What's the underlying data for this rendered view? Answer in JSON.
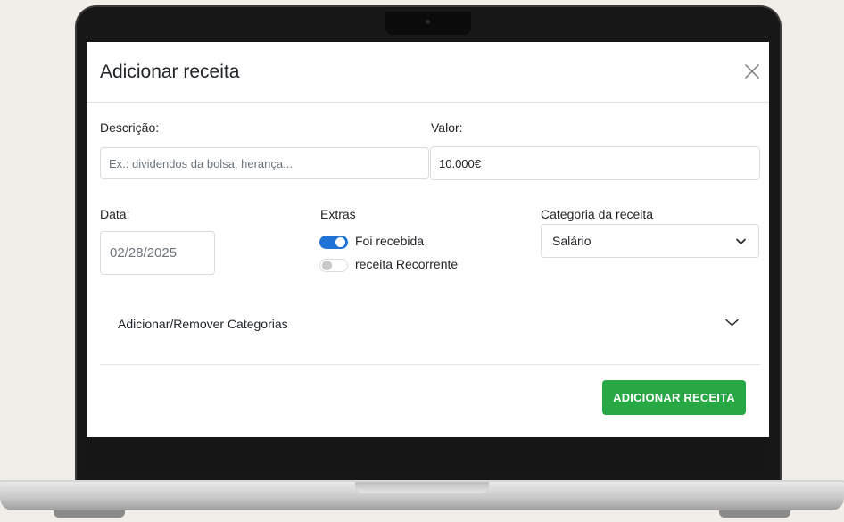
{
  "modal": {
    "title": "Adicionar receita",
    "close_icon": "close-icon"
  },
  "form": {
    "descricao": {
      "label": "Descrição:",
      "placeholder": "Ex.: dividendos da bolsa, herança..."
    },
    "valor": {
      "label": "Valor:",
      "value": "10.000€"
    },
    "data": {
      "label": "Data:",
      "value": "02/28/2025"
    },
    "extras": {
      "label": "Extras",
      "toggles": [
        {
          "label": "Foi recebida",
          "checked": true
        },
        {
          "label": "receita Recorrente",
          "checked": false
        }
      ]
    },
    "categoria": {
      "label": "Categoria da receita",
      "value": "Salário",
      "icon": "chevron-down-icon"
    }
  },
  "accordion": {
    "label": "Adicionar/Remover Categorias",
    "icon": "chevron-down-icon"
  },
  "footer": {
    "submit_label": "ADICIONAR RECEITA"
  },
  "colors": {
    "primary": "#1e73d4",
    "success": "#28a745",
    "background": "#f1ede8"
  }
}
